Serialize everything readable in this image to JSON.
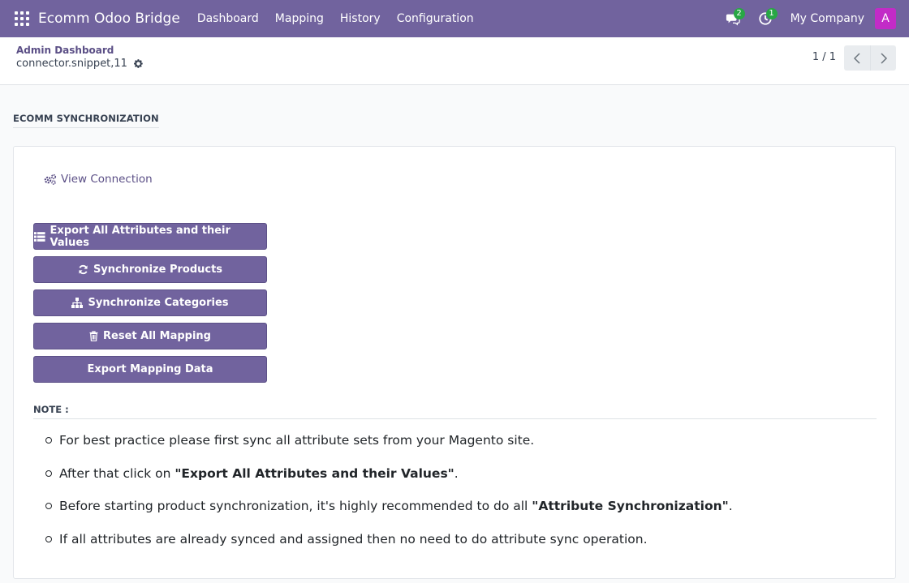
{
  "navbar": {
    "brand": "Ecomm Odoo Bridge",
    "menu": [
      "Dashboard",
      "Mapping",
      "History",
      "Configuration"
    ],
    "messages_badge": "2",
    "activities_badge": "1",
    "company": "My Company",
    "avatar_letter": "A",
    "avatar_color": "#c22bc7",
    "bar_color": "#71639e"
  },
  "control_panel": {
    "breadcrumb": "Admin Dashboard",
    "record_name": "connector.snippet,11",
    "pager": "1 / 1"
  },
  "content": {
    "section_title": "ECOMM SYNCHRONIZATION",
    "view_connection": "View Connection",
    "buttons": [
      {
        "label": "Export All Attributes and their Values",
        "icon": "list-icon"
      },
      {
        "label": "Synchronize Products",
        "icon": "refresh-icon"
      },
      {
        "label": "Synchronize Categories",
        "icon": "sitemap-icon"
      },
      {
        "label": "Reset All Mapping",
        "icon": "trash-icon"
      },
      {
        "label": "Export Mapping Data",
        "icon": ""
      }
    ],
    "note_label": "NOTE :",
    "notes": [
      {
        "before": "For best practice please first sync all attribute sets from your Magento site.",
        "bold": "",
        "after": ""
      },
      {
        "before": "After that click on ",
        "bold": "\"Export All Attributes and their Values\"",
        "after": "."
      },
      {
        "before": "Before starting product synchronization, it's highly recommended to do all ",
        "bold": "\"Attribute Synchronization\"",
        "after": "."
      },
      {
        "before": "If all attributes are already synced and assigned then no need to do attribute sync operation.",
        "bold": "",
        "after": ""
      }
    ]
  }
}
